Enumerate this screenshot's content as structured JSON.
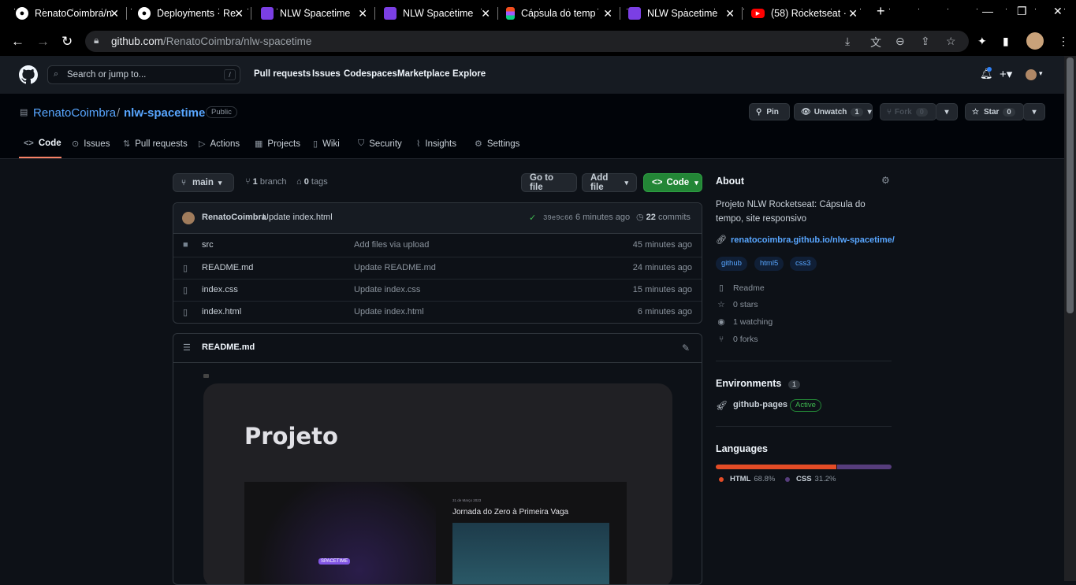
{
  "browser": {
    "tabs": [
      {
        "title": "RenatoCoimbra/n",
        "icon": "github-icon"
      },
      {
        "title": "Deployments · Re",
        "icon": "github-icon"
      },
      {
        "title": "NLW Spacetime",
        "icon": "nlw-icon"
      },
      {
        "title": "NLW Spacetime",
        "icon": "nlw-icon"
      },
      {
        "title": "Cápsula do temp",
        "icon": "figma-icon"
      },
      {
        "title": "NLW Spacetime",
        "icon": "nlw-icon"
      },
      {
        "title": "(58) Rocketseat ·",
        "icon": "youtube-icon"
      }
    ],
    "url_domain": "github.com",
    "url_path": "/RenatoCoimbra/nlw-spacetime"
  },
  "header": {
    "search_placeholder": "Search or jump to...",
    "slash_key": "/",
    "nav": [
      "Pull requests",
      "Issues",
      "Codespaces",
      "Marketplace",
      "Explore"
    ]
  },
  "repo": {
    "owner": "RenatoCoimbra",
    "separator": "/",
    "name": "nlw-spacetime",
    "visibility": "Public",
    "pin_label": "Pin",
    "unwatch_label": "Unwatch",
    "watch_count": "1",
    "fork_label": "Fork",
    "fork_count": "0",
    "star_label": "Star",
    "star_count": "0",
    "tabs": [
      "Code",
      "Issues",
      "Pull requests",
      "Actions",
      "Projects",
      "Wiki",
      "Security",
      "Insights",
      "Settings"
    ]
  },
  "toolbar": {
    "branch": "main",
    "branch_count": "1",
    "branch_word": "branch",
    "tag_count": "0",
    "tag_word": "tags",
    "go_to_file": "Go to file",
    "add_file": "Add file",
    "code": "Code"
  },
  "commit": {
    "author": "RenatoCoimbra",
    "message": "Update index.html",
    "sha": "39e9c66",
    "age": "6 minutes ago",
    "count": "22",
    "count_word": "commits"
  },
  "files": [
    {
      "name": "src",
      "message": "Add files via upload",
      "age": "45 minutes ago",
      "type": "folder"
    },
    {
      "name": "README.md",
      "message": "Update README.md",
      "age": "24 minutes ago",
      "type": "file"
    },
    {
      "name": "index.css",
      "message": "Update index.css",
      "age": "15 minutes ago",
      "type": "file"
    },
    {
      "name": "index.html",
      "message": "Update index.html",
      "age": "6 minutes ago",
      "type": "file"
    }
  ],
  "readme": {
    "title": "README.md",
    "heading": "Projeto",
    "preview_date": "31 de Março 2023",
    "preview_title": "Jornada do Zero à Primeira Vaga",
    "preview_logo": "SPACETIME"
  },
  "about": {
    "title": "About",
    "description": "Projeto NLW Rocketseat: Cápsula do tempo, site responsivo",
    "link": "renatocoimbra.github.io/nlw-spacetime/",
    "topics": [
      "github",
      "html5",
      "css3"
    ],
    "readme": "Readme",
    "stars": "0 stars",
    "watching": "1 watching",
    "forks": "0 forks"
  },
  "environments": {
    "title": "Environments",
    "count": "1",
    "name": "github-pages",
    "status": "Active"
  },
  "languages": {
    "title": "Languages",
    "items": [
      {
        "name": "HTML",
        "percent": "68.8%",
        "value": 68.8,
        "color": "#e34c26"
      },
      {
        "name": "CSS",
        "percent": "31.2%",
        "value": 31.2,
        "color": "#563d7c"
      }
    ]
  }
}
